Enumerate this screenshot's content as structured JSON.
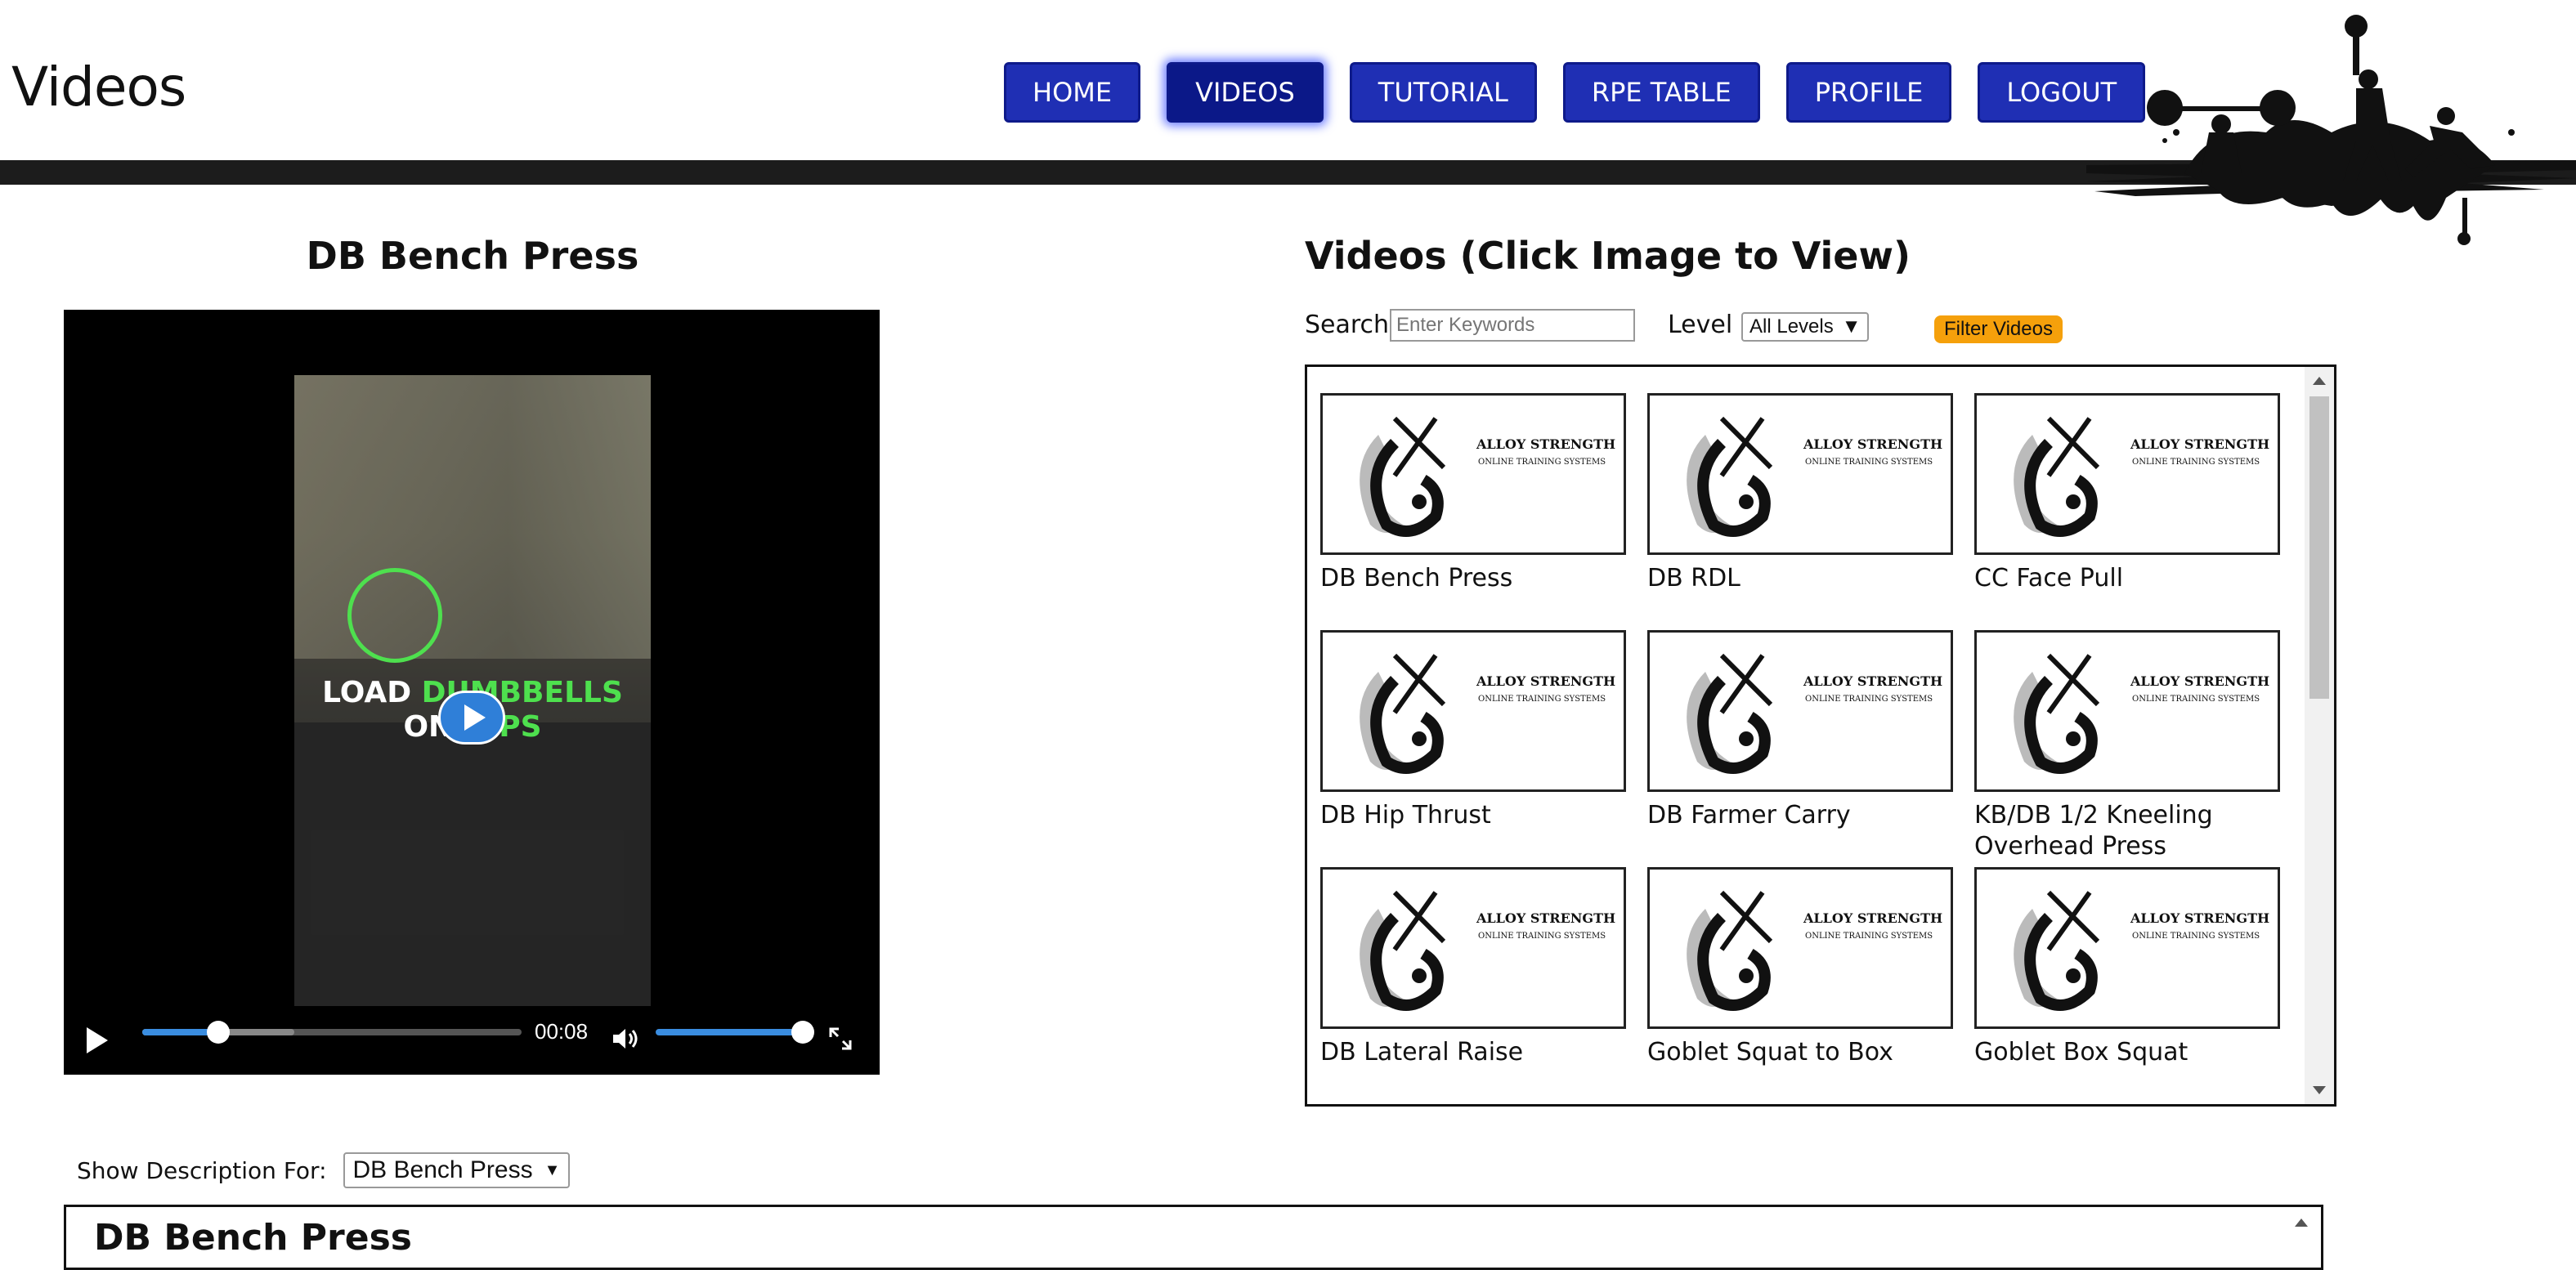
{
  "header": {
    "title": "Videos",
    "nav": [
      "HOME",
      "VIDEOS",
      "TUTORIAL",
      "RPE TABLE",
      "PROFILE",
      "LOGOUT"
    ],
    "active_nav": "VIDEOS"
  },
  "player": {
    "title": "DB Bench Press",
    "overlay_line1_a": "LOAD ",
    "overlay_line1_b": "DUMBBELLS",
    "overlay_line2_a": "ON ",
    "overlay_line2_b": "HIPS",
    "time": "00:08",
    "progress": 0.2,
    "buffered": 0.4,
    "volume": 1.0,
    "icons": [
      "play-icon",
      "volume-icon",
      "fullscreen-icon"
    ]
  },
  "videos": {
    "heading": "Videos (Click Image to View)",
    "search_label": "Search",
    "search_placeholder": "Enter Keywords",
    "level_label": "Level",
    "level_selected": "All Levels",
    "filter_button": "Filter Videos",
    "thumb_brand": "ALLOY STRENGTH",
    "thumb_sub": "ONLINE TRAINING SYSTEMS",
    "items": [
      "DB Bench Press",
      "DB RDL",
      "CC Face Pull",
      "DB Hip Thrust",
      "DB Farmer Carry",
      "KB/DB 1/2 Kneeling Overhead Press",
      "DB Lateral Raise",
      "Goblet Squat to Box",
      "Goblet Box Squat"
    ]
  },
  "description": {
    "label": "Show Description For:",
    "selected": "DB Bench Press",
    "title": "DB Bench Press"
  },
  "colors": {
    "nav_bg": "#1f2fb4",
    "nav_active": "#0b1888",
    "accent_blue": "#3a8de0",
    "filter_btn": "#f5a00b",
    "overlay_green": "#4ee04e"
  }
}
